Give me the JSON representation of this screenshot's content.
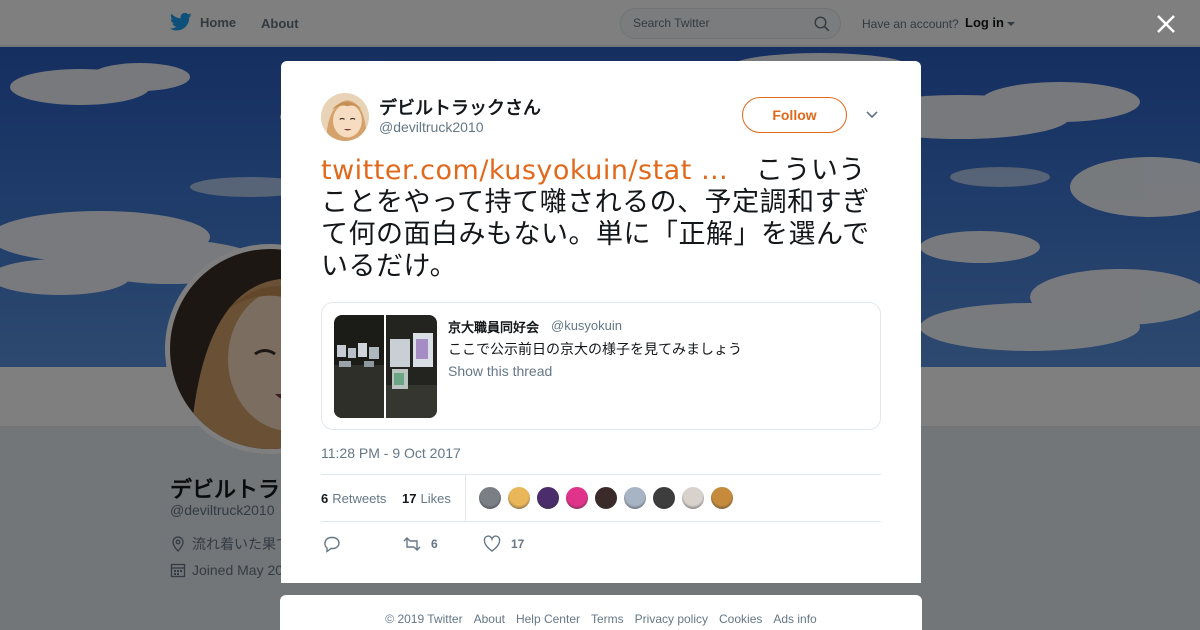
{
  "nav": {
    "home_label": "Home",
    "about_label": "About",
    "search_placeholder": "Search Twitter",
    "have_account": "Have an account?",
    "login_label": "Log in"
  },
  "profile": {
    "name": "デビルトラ",
    "handle": "@deviltruck2010",
    "location": "流れ着いた果て",
    "joined": "Joined May 20"
  },
  "tweet": {
    "name": "デビルトラックさん",
    "handle": "@deviltruck2010",
    "follow_label": "Follow",
    "link_text": "twitter.com/kusyokuin/stat …",
    "body_text": "　こういうことをやって持て囃されるの、予定調和すぎて何の面白みもない。単に「正解」を選んでいるだけ。",
    "timestamp": "11:28 PM - 9 Oct 2017",
    "retweets_count": "6",
    "retweets_label": "Retweets",
    "likes_count": "17",
    "likes_label": "Likes",
    "action_retweet_count": "6",
    "action_like_count": "17"
  },
  "quoted": {
    "name": "京大職員同好会",
    "handle": "@kusyokuin",
    "text": "ここで公示前日の京大の様子を見てみましょう",
    "thread_label": "Show this thread"
  },
  "footer": {
    "links": [
      "© 2019 Twitter",
      "About",
      "Help Center",
      "Terms",
      "Privacy policy",
      "Cookies",
      "Ads info"
    ]
  },
  "colors": {
    "accent": "#e0691c",
    "twitter_blue": "#1da1f2",
    "muted": "#657786"
  },
  "liker_colors": [
    "#7a7f86",
    "#e9b65a",
    "#4b2d6b",
    "#e0338a",
    "#3a2a2a",
    "#a7b4c4",
    "#3d3d3d",
    "#d8d2cd",
    "#c58a3c"
  ]
}
